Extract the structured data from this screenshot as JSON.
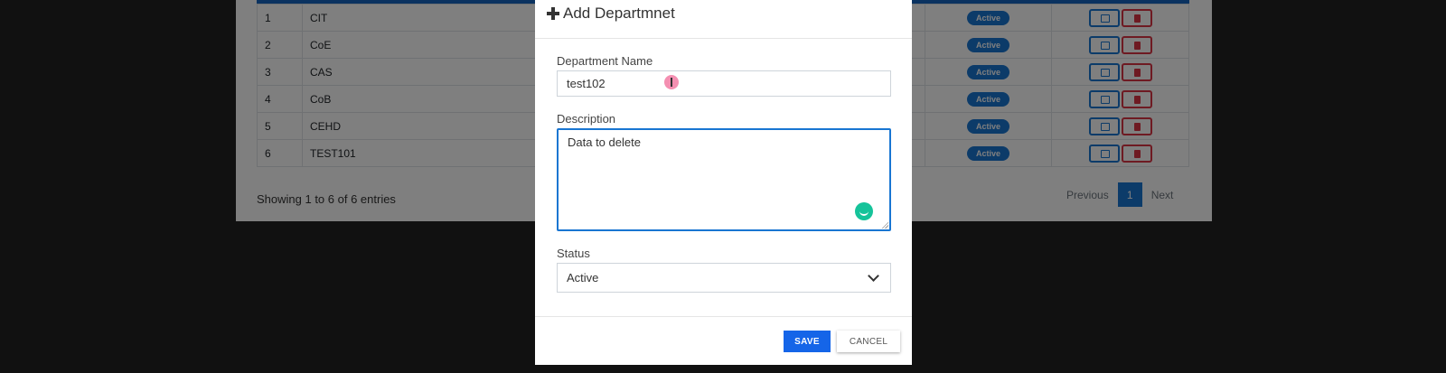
{
  "table": {
    "rows": [
      {
        "num": "1",
        "name": "CIT",
        "status": "Active"
      },
      {
        "num": "2",
        "name": "CoE",
        "status": "Active"
      },
      {
        "num": "3",
        "name": "CAS",
        "status": "Active"
      },
      {
        "num": "4",
        "name": "CoB",
        "status": "Active"
      },
      {
        "num": "5",
        "name": "CEHD",
        "status": "Active"
      },
      {
        "num": "6",
        "name": "TEST101",
        "status": "Active"
      }
    ],
    "showing": "Showing 1 to 6 of 6 entries"
  },
  "pagination": {
    "previous": "Previous",
    "page": "1",
    "next": "Next"
  },
  "modal": {
    "title": "Add Departmnet",
    "department_name_label": "Department Name",
    "department_name_value": "test102",
    "description_label": "Description",
    "description_value": "Data to delete",
    "status_label": "Status",
    "status_value": "Active",
    "save_label": "SAVE",
    "cancel_label": "CANCEL"
  },
  "colors": {
    "accent": "#1976d2",
    "danger": "#dc3545",
    "save": "#1565e8"
  }
}
